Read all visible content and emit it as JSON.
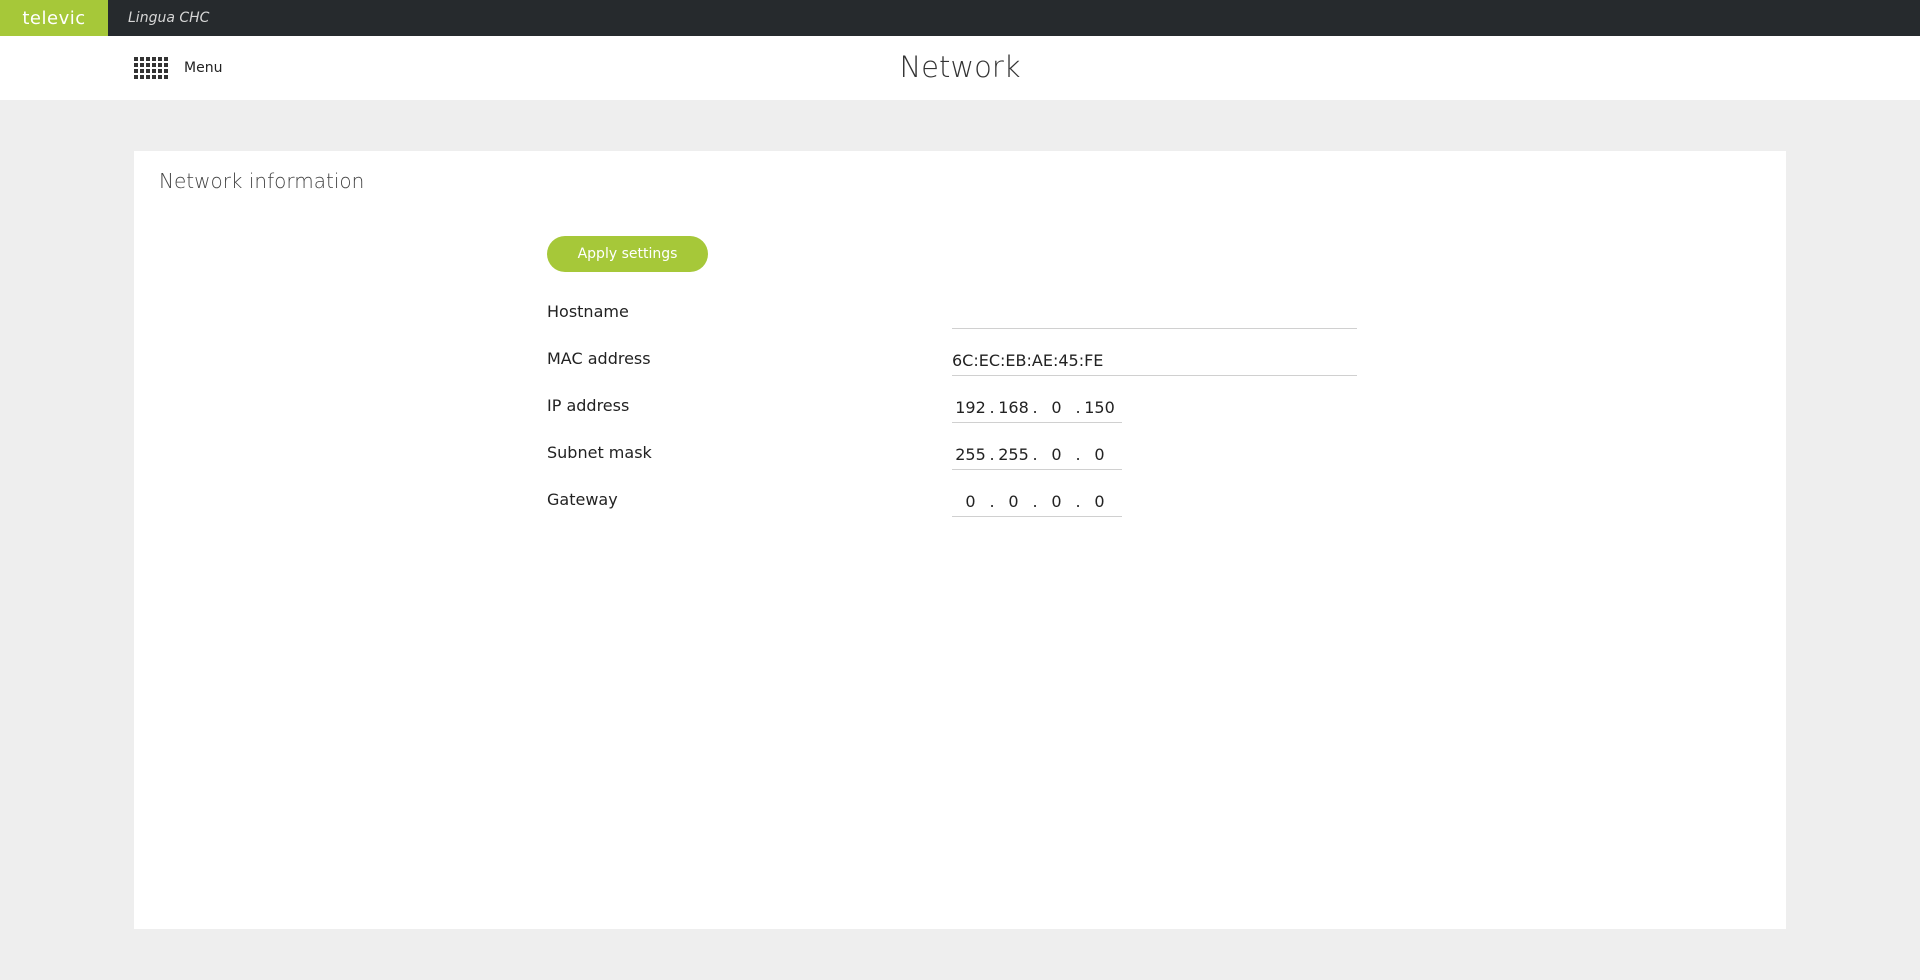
{
  "app": {
    "brand": "televic",
    "name": "Lingua CHC"
  },
  "header": {
    "menu_label": "Menu",
    "title": "Network"
  },
  "card": {
    "title": "Network information",
    "apply_label": "Apply settings",
    "fields": {
      "hostname": {
        "label": "Hostname",
        "value": ""
      },
      "mac": {
        "label": "MAC address",
        "value": "6C:EC:EB:AE:45:FE"
      },
      "ip": {
        "label": "IP address",
        "octets": [
          "192",
          "168",
          "0",
          "150"
        ]
      },
      "subnet": {
        "label": "Subnet mask",
        "octets": [
          "255",
          "255",
          "0",
          "0"
        ]
      },
      "gateway": {
        "label": "Gateway",
        "octets": [
          "0",
          "0",
          "0",
          "0"
        ]
      }
    },
    "separator": "."
  },
  "colors": {
    "accent": "#a6c839",
    "topbar": "#262a2d",
    "background": "#eeeeee"
  },
  "icons": {
    "menu": "grid-icon"
  }
}
